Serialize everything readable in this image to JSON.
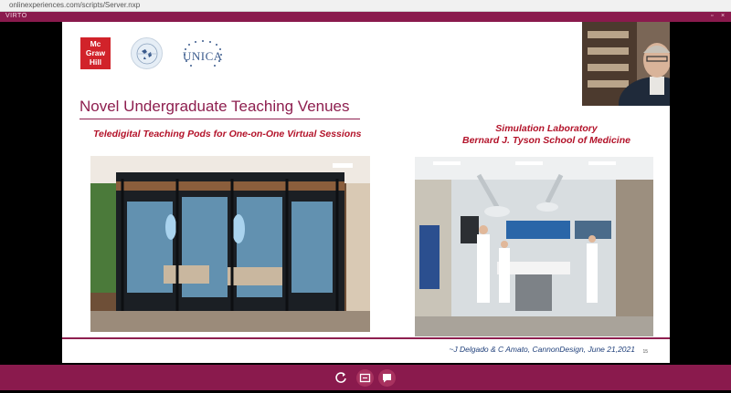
{
  "browser": {
    "url": "onlinexperiences.com/scripts/Server.nxp"
  },
  "titlebar": {
    "app_name": "VIRTO",
    "restore_glyph": "▫",
    "close_glyph": "×"
  },
  "slide": {
    "logos": {
      "mcgrawhill_lines": [
        "Mc",
        "Graw",
        "Hill"
      ],
      "unica_text": "UNICA"
    },
    "title": "Novel Undergraduate Teaching Venues",
    "left_subtitle": "Teledigital Teaching Pods for One-on-One Virtual Sessions",
    "right_subtitle_line1": "Simulation Laboratory",
    "right_subtitle_line2": "Bernard J. Tyson School of Medicine",
    "citation": "~J Delgado &  C Amato, CannonDesign, June 21,2021",
    "page_number": "15"
  },
  "controls": {
    "refresh_icon": "refresh-icon",
    "slides_icon": "slides-icon",
    "chat_icon": "chat-icon"
  },
  "colors": {
    "brand_maroon": "#8a1a4d",
    "title_color": "#8e1f4f",
    "subtitle_red": "#b3132a"
  }
}
